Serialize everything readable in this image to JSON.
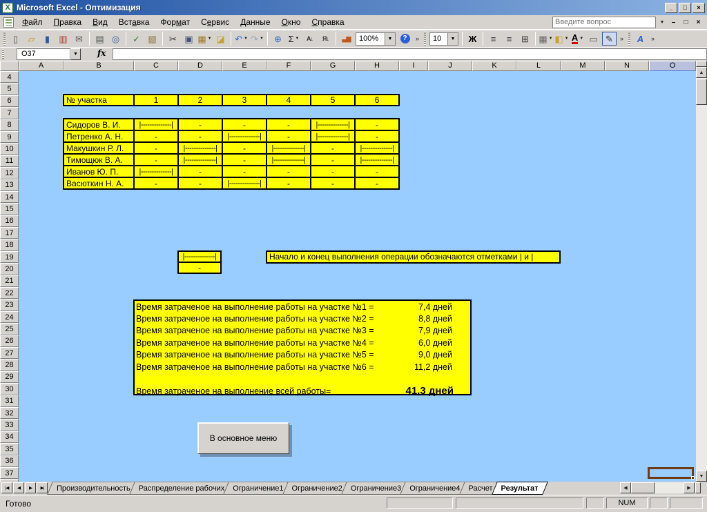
{
  "window": {
    "title": "Microsoft Excel - Оптимизация",
    "controls": {
      "minimize": "_",
      "restore": "□",
      "close": "×"
    },
    "doc_controls": {
      "minimize": "–",
      "restore": "□",
      "close": "×"
    }
  },
  "menu_bar": {
    "question_placeholder": "Введите вопрос",
    "items": [
      {
        "id": "file",
        "pre": "",
        "key": "Ф",
        "post": "айл"
      },
      {
        "id": "edit",
        "pre": "",
        "key": "П",
        "post": "равка"
      },
      {
        "id": "view",
        "pre": "",
        "key": "В",
        "post": "ид"
      },
      {
        "id": "insert",
        "pre": "Вст",
        "key": "а",
        "post": "вка"
      },
      {
        "id": "format",
        "pre": "Фор",
        "key": "м",
        "post": "ат"
      },
      {
        "id": "tools",
        "pre": "С",
        "key": "е",
        "post": "рвис"
      },
      {
        "id": "data",
        "pre": "",
        "key": "Д",
        "post": "анные"
      },
      {
        "id": "window",
        "pre": "",
        "key": "О",
        "post": "кно"
      },
      {
        "id": "help",
        "pre": "",
        "key": "С",
        "post": "правка"
      }
    ]
  },
  "toolbar": {
    "items": [
      {
        "kind": "grip",
        "name": "toolbar-grip"
      },
      {
        "name": "new-document-icon",
        "glyph": "▯",
        "color": "#4a4a4a"
      },
      {
        "name": "open-folder-icon",
        "glyph": "▱",
        "color": "#c98f1b"
      },
      {
        "name": "save-icon",
        "glyph": "▮",
        "color": "#31589c"
      },
      {
        "name": "permission-icon",
        "glyph": "▥",
        "color": "#b03a2e"
      },
      {
        "name": "mail-attachment-icon",
        "glyph": "✉",
        "color": "#5a5a5a"
      },
      {
        "kind": "sep",
        "name": "toolbar-separator"
      },
      {
        "name": "print-icon",
        "glyph": "▤",
        "color": "#555555"
      },
      {
        "name": "print-preview-icon",
        "glyph": "◎",
        "color": "#31589c"
      },
      {
        "kind": "sep",
        "name": "toolbar-separator"
      },
      {
        "name": "spelling-icon",
        "glyph": "✓",
        "color": "#2e7d32"
      },
      {
        "name": "research-icon",
        "glyph": "▧",
        "color": "#8a6d3b"
      },
      {
        "kind": "sep",
        "name": "toolbar-separator"
      },
      {
        "name": "cut-icon",
        "glyph": "✂",
        "color": "#3a3a3a"
      },
      {
        "name": "copy-icon",
        "glyph": "▣",
        "color": "#44507a"
      },
      {
        "name": "paste-icon",
        "glyph": "▦",
        "color": "#a0792c",
        "dd": true
      },
      {
        "name": "format-painter-icon",
        "glyph": "◪",
        "color": "#c9a227"
      },
      {
        "kind": "sep",
        "name": "toolbar-separator"
      },
      {
        "name": "undo-icon",
        "glyph": "↶",
        "color": "#2b5fd9",
        "dd": true
      },
      {
        "name": "redo-icon",
        "glyph": "↷",
        "color": "#9aa4b8",
        "dd": true
      },
      {
        "kind": "sep",
        "name": "toolbar-separator"
      },
      {
        "name": "hyperlink-icon",
        "glyph": "⊕",
        "color": "#2b5fd9"
      },
      {
        "name": "autosum-icon",
        "glyph": "Σ",
        "color": "#1a1a1a",
        "dd": true
      },
      {
        "name": "sort-ascending-icon",
        "glyph": "А↓",
        "color": "#333333",
        "small": true
      },
      {
        "name": "sort-descending-icon",
        "glyph": "Я↓",
        "color": "#333333",
        "small": true
      },
      {
        "kind": "sep",
        "name": "toolbar-separator"
      },
      {
        "name": "chart-wizard-icon",
        "glyph": "▃▆",
        "color": "#c2571a",
        "small": true
      },
      {
        "kind": "combo",
        "name": "zoom-combo",
        "value": "100%",
        "width": 58
      },
      {
        "name": "help-icon",
        "glyph": "?",
        "circle": "#2b5fd9"
      },
      {
        "kind": "chev",
        "name": "toolbar-options-chevron",
        "glyph": "»"
      },
      {
        "kind": "grip",
        "name": "toolbar-grip"
      },
      {
        "kind": "combo",
        "name": "font-size-combo",
        "value": "10",
        "width": 42
      },
      {
        "kind": "sep",
        "name": "toolbar-separator"
      },
      {
        "name": "bold-button",
        "glyph": "Ж",
        "color": "#000000",
        "bold": true
      },
      {
        "kind": "sep",
        "name": "toolbar-separator"
      },
      {
        "name": "align-left-icon",
        "glyph": "≡",
        "color": "#333333"
      },
      {
        "name": "align-right-icon",
        "glyph": "≡",
        "color": "#333333"
      },
      {
        "name": "merge-center-icon",
        "glyph": "⊞",
        "color": "#333333"
      },
      {
        "kind": "sep",
        "name": "toolbar-separator"
      },
      {
        "name": "borders-icon",
        "glyph": "▦",
        "color": "#666666",
        "dd": true
      },
      {
        "name": "fill-color-icon",
        "glyph": "◧",
        "color": "#c9a227",
        "dd": true
      },
      {
        "name": "font-color-icon",
        "glyph": "А",
        "color": "#000000",
        "underline": true,
        "dd": true
      },
      {
        "name": "button-tool-icon",
        "glyph": "▭",
        "color": "#555555"
      },
      {
        "name": "pencil-tool-icon",
        "glyph": "✎",
        "color": "#333333",
        "active": true
      },
      {
        "kind": "chev",
        "name": "toolbar-options-chevron",
        "glyph": "»"
      },
      {
        "kind": "grip",
        "name": "toolbar-grip"
      },
      {
        "name": "wordart-icon",
        "glyph": "A",
        "color": "#2b5fd9",
        "italic": true,
        "bold": true
      },
      {
        "kind": "chev",
        "name": "toolbar-options-chevron",
        "glyph": "»"
      }
    ]
  },
  "formula_bar": {
    "name_box": "O37",
    "fx_label": "fx"
  },
  "grid": {
    "column_headers": [
      "A",
      "B",
      "C",
      "D",
      "E",
      "F",
      "G",
      "H",
      "I",
      "J",
      "K",
      "L",
      "M",
      "N",
      "O"
    ],
    "selected_column": "O",
    "selected_cell": "O37",
    "row_start": 4,
    "row_end": 38
  },
  "sheet": {
    "area_table": {
      "header_label": "№ участка",
      "columns": [
        "1",
        "2",
        "3",
        "4",
        "5",
        "6"
      ]
    },
    "workers": [
      {
        "name": "Сидоров В. И.",
        "cells": [
          "|--------------|",
          "-",
          "-",
          "-",
          "|--------------|",
          "-"
        ]
      },
      {
        "name": "Петренко А. Н.",
        "cells": [
          "-",
          "-",
          "|--------------|",
          "-",
          "|--------------|",
          "-"
        ]
      },
      {
        "name": "Макушкин Р. Л.",
        "cells": [
          "-",
          "|--------------|",
          "-",
          "|--------------|",
          "-",
          "|--------------|"
        ]
      },
      {
        "name": "Тимощюк В. А.",
        "cells": [
          "-",
          "|--------------|",
          "-",
          "|--------------|",
          "-",
          "|--------------|"
        ]
      },
      {
        "name": "Иванов Ю. П.",
        "cells": [
          "|--------------|",
          "-",
          "-",
          "-",
          "-",
          "-"
        ]
      },
      {
        "name": "Васюткин Н. А.",
        "cells": [
          "-",
          "-",
          "|--------------|",
          "-",
          "-",
          "-"
        ]
      }
    ],
    "legend": {
      "bar": "|--------------|",
      "dash": "-",
      "note": "Начало и конец выполнения операции обозначаются отметками | и |"
    },
    "results": {
      "lines": [
        {
          "label": "Время затраченое на выполнение работы на участке №1 =",
          "value": "7,4 дней"
        },
        {
          "label": "Время затраченое на выполнение работы на участке №2 =",
          "value": "8,8 дней"
        },
        {
          "label": "Время затраченое на выполнение работы на участке №3 =",
          "value": "7,9 дней"
        },
        {
          "label": "Время затраченое на выполнение работы на участке №4 =",
          "value": "6,0 дней"
        },
        {
          "label": "Время затраченое на выполнение работы на участке №5 =",
          "value": "9,0 дней"
        },
        {
          "label": "Время затраченое на выполнение работы на участке №6 =",
          "value": "11,2 дней"
        }
      ],
      "total_label": "Время затраченое на выполнение всей работы=",
      "total_value": "41,3 дней"
    },
    "menu_button_label": "В основное меню"
  },
  "tabs": {
    "nav": [
      {
        "id": "first",
        "glyph": "|◀"
      },
      {
        "id": "prev",
        "glyph": "◀"
      },
      {
        "id": "next",
        "glyph": "▶"
      },
      {
        "id": "last",
        "glyph": "▶|"
      }
    ],
    "items": [
      {
        "id": "productivity",
        "label": "Производительность",
        "active": false
      },
      {
        "id": "workers-distribution",
        "label": "Распределение рабочих",
        "active": false
      },
      {
        "id": "constraint-1",
        "label": "Ограничение1",
        "active": false
      },
      {
        "id": "constraint-2",
        "label": "Ограничение2",
        "active": false
      },
      {
        "id": "constraint-3",
        "label": "Ограничение3",
        "active": false
      },
      {
        "id": "constraint-4",
        "label": "Ограничение4",
        "active": false
      },
      {
        "id": "calculation",
        "label": "Расчет",
        "active": false
      },
      {
        "id": "result",
        "label": "Результат",
        "active": true
      }
    ]
  },
  "status_bar": {
    "mode": "Готово",
    "num": "NUM"
  },
  "icons": {
    "dropdown": "▼",
    "scroll_up": "▲",
    "scroll_down": "▼",
    "scroll_left": "◀",
    "scroll_right": "▶"
  },
  "colors": {
    "cell_fill": "#FFFF00",
    "sheet_background": "#99CCFF",
    "selection_border": "#6E3B17",
    "title_gradient": [
      "#1E50A2",
      "#8DB3E2"
    ]
  }
}
